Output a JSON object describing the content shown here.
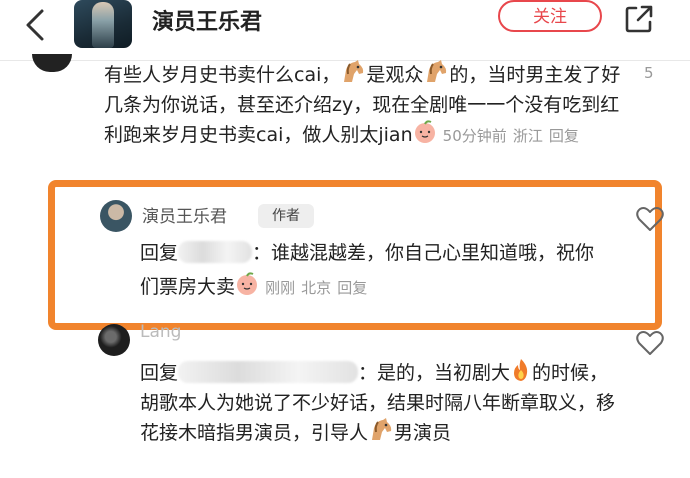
{
  "header": {
    "title": "演员王乐君",
    "follow_label": "关注"
  },
  "comments": [
    {
      "text_before": "有些人岁月史书卖什么cai，",
      "text_mid1": "是观众",
      "text_mid2": "的，当时男主发了好几条为你说话，甚至还介绍zy，现在全剧唯一一个没有吃到红利跑来岁月史书卖cai，做人别太jian",
      "time": "50分钟前",
      "location": "浙江",
      "reply_label": "回复",
      "like_count": "5"
    },
    {
      "author": "演员王乐君",
      "badge": "作者",
      "reply_prefix": "回复",
      "text": "：谁越混越差，你自己心里知道哦，祝你们票房大卖",
      "time": "刚刚",
      "location": "北京",
      "reply_label": "回复"
    },
    {
      "author": "Lang",
      "reply_prefix": "回复",
      "text_a": "：是的，当初剧大",
      "text_b": "的时候，胡歌本人为她说了不少好话，结果时隔八年断章取义，移花接木暗指男演员，引导人",
      "text_c": "男演员"
    }
  ],
  "colors": {
    "accent": "#e8474c",
    "highlight_border": "#f1842d"
  },
  "icons": [
    "back-arrow-icon",
    "share-icon",
    "horse-emoji-icon",
    "peach-emoji-icon",
    "fire-emoji-icon",
    "heart-icon"
  ]
}
